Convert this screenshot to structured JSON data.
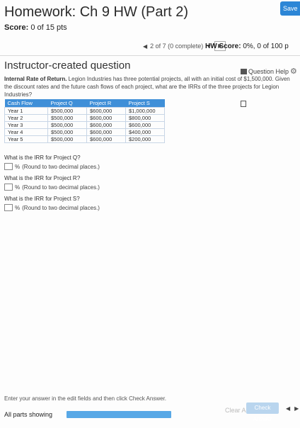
{
  "header": {
    "title": "Homework: Ch 9 HW (Part 2)",
    "save_label": "Save",
    "score_label": "Score:",
    "score_value": "0 of 15 pts",
    "progress_text": "2 of 7 (0 complete)",
    "hw_score_label": "HW Score:",
    "hw_score_value": "0%, 0 of 100 p"
  },
  "question": {
    "title": "Instructor-created question",
    "help_label": "Question Help",
    "prompt_bold": "Internal Rate of Return.",
    "prompt_text": " Legion Industries has three potential projects, all with an initial cost of $1,500,000. Given the discount rates and the future cash flows of each project, what are the IRRs of the three projects for Legion Industries?"
  },
  "cash_flows": {
    "headers": [
      "Cash Flow",
      "Project Q",
      "Project R",
      "Project S"
    ],
    "rows": [
      [
        "Year 1",
        "$500,000",
        "$600,000",
        "$1,000,000"
      ],
      [
        "Year 2",
        "$500,000",
        "$600,000",
        "$800,000"
      ],
      [
        "Year 3",
        "$500,000",
        "$600,000",
        "$600,000"
      ],
      [
        "Year 4",
        "$500,000",
        "$600,000",
        "$400,000"
      ],
      [
        "Year 5",
        "$500,000",
        "$600,000",
        "$200,000"
      ]
    ]
  },
  "answers": {
    "q_irr": "What is the IRR for Project Q?",
    "r_irr": "What is the IRR for Project R?",
    "s_irr": "What is the IRR for Project S?",
    "unit": "%",
    "hint": "(Round to two decimal places.)"
  },
  "footer": {
    "instruction": "Enter your answer in the edit fields and then click Check Answer.",
    "parts_label": "All parts showing",
    "clear_all": "Clear All",
    "check_answer": "Check Answer"
  }
}
